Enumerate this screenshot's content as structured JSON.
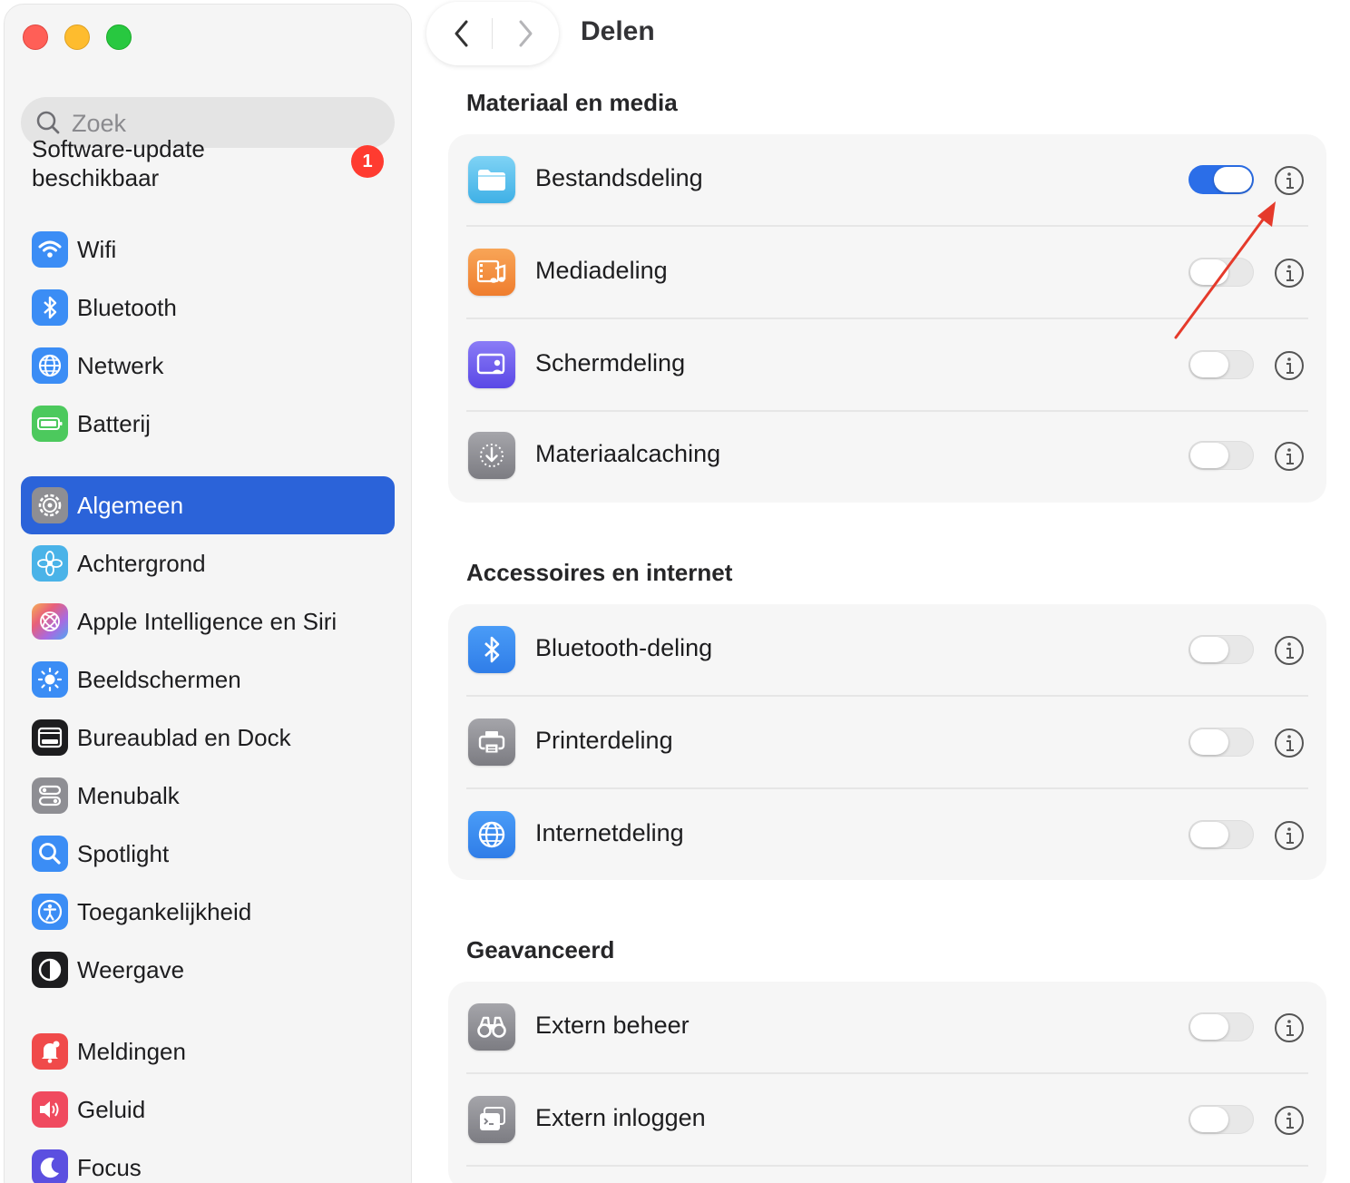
{
  "window": {
    "title": "Delen"
  },
  "sidebar": {
    "search_placeholder": "Zoek",
    "update": {
      "label": "Software-update beschikbaar",
      "badge": "1"
    },
    "items": [
      {
        "label": "Wifi",
        "icon": "wifi-icon",
        "color": "#3b8df5"
      },
      {
        "label": "Bluetooth",
        "icon": "bluetooth-icon",
        "color": "#3b8df5"
      },
      {
        "label": "Netwerk",
        "icon": "globe-icon",
        "color": "#3b8df5"
      },
      {
        "label": "Batterij",
        "icon": "battery-icon",
        "color": "#4cc95d"
      },
      {
        "label": "Algemeen",
        "icon": "gear-icon",
        "color": "#8e8e93",
        "selected": true
      },
      {
        "label": "Achtergrond",
        "icon": "flower-icon",
        "color": "#4ab3e8"
      },
      {
        "label": "Apple Intelligence en Siri",
        "icon": "siri-icon",
        "color": "#e88a6a"
      },
      {
        "label": "Beeldschermen",
        "icon": "sun-icon",
        "color": "#3b8df5"
      },
      {
        "label": "Bureaublad en Dock",
        "icon": "dock-icon",
        "color": "#1d1d1f"
      },
      {
        "label": "Menubalk",
        "icon": "menubar-icon",
        "color": "#8e8e93"
      },
      {
        "label": "Spotlight",
        "icon": "magnifier-icon",
        "color": "#3b8df5"
      },
      {
        "label": "Toegankelijkheid",
        "icon": "accessibility-icon",
        "color": "#3b8df5"
      },
      {
        "label": "Weergave",
        "icon": "appearance-icon",
        "color": "#1d1d1f"
      },
      {
        "label": "Meldingen",
        "icon": "bell-icon",
        "color": "#f04a4a"
      },
      {
        "label": "Geluid",
        "icon": "speaker-icon",
        "color": "#f04a5f"
      },
      {
        "label": "Focus",
        "icon": "moon-icon",
        "color": "#5b4fe0"
      }
    ]
  },
  "main": {
    "sections": [
      {
        "title": "Materiaal en media",
        "rows": [
          {
            "label": "Bestandsdeling",
            "icon": "folder-icon",
            "on": true
          },
          {
            "label": "Mediadeling",
            "icon": "media-icon",
            "on": false
          },
          {
            "label": "Schermdeling",
            "icon": "screen-share-icon",
            "on": false
          },
          {
            "label": "Materiaalcaching",
            "icon": "download-cache-icon",
            "on": false
          }
        ]
      },
      {
        "title": "Accessoires en internet",
        "rows": [
          {
            "label": "Bluetooth-deling",
            "icon": "bluetooth-icon",
            "on": false
          },
          {
            "label": "Printerdeling",
            "icon": "printer-icon",
            "on": false
          },
          {
            "label": "Internetdeling",
            "icon": "globe-icon",
            "on": false
          }
        ]
      },
      {
        "title": "Geavanceerd",
        "rows": [
          {
            "label": "Extern beheer",
            "icon": "binoculars-icon",
            "on": false
          },
          {
            "label": "Extern inloggen",
            "icon": "terminal-icon",
            "on": false
          }
        ]
      }
    ]
  },
  "colors": {
    "accent": "#2b63d9",
    "toggle_on": "#2b6ee8",
    "annotation_arrow": "#e53a2b"
  }
}
